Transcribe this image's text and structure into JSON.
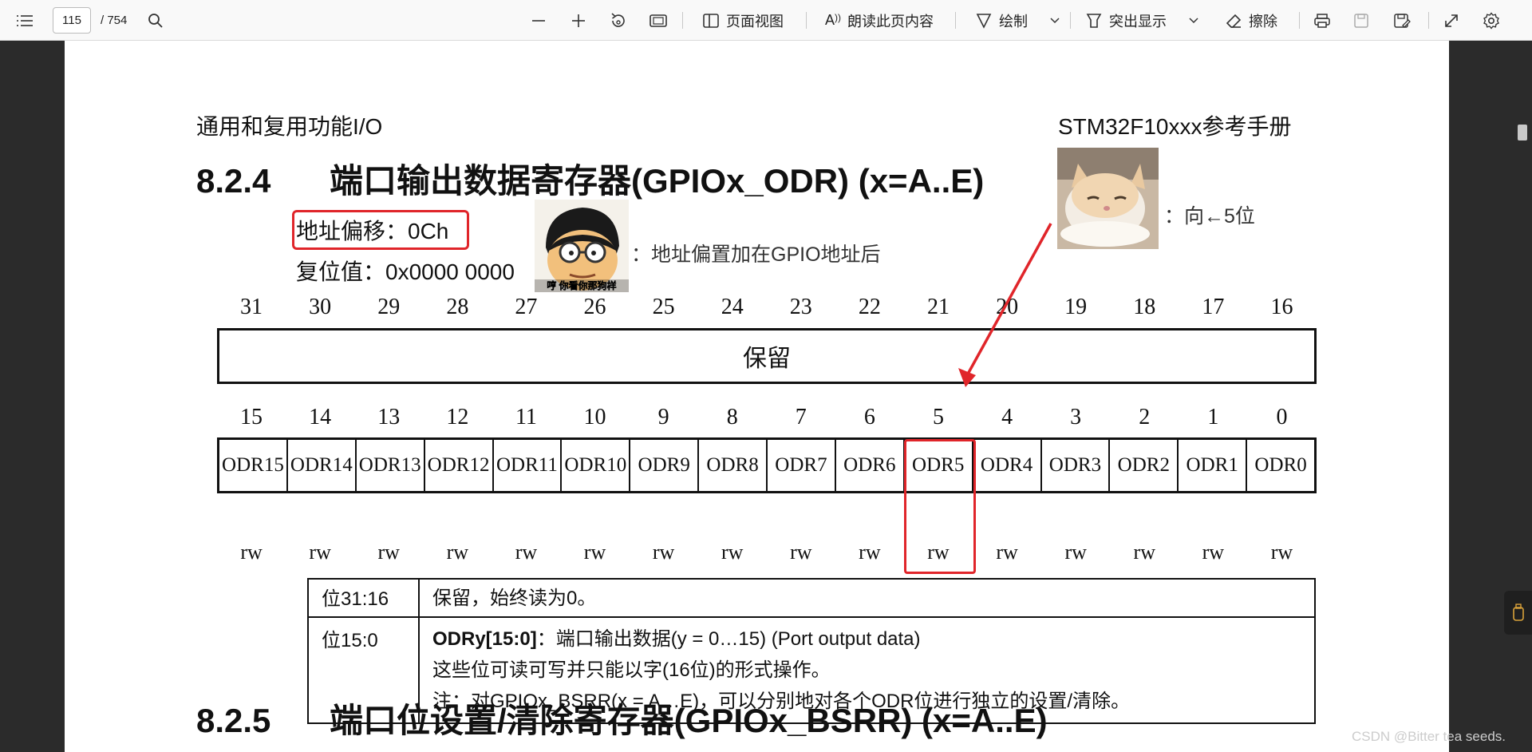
{
  "toolbar": {
    "page_current": "115",
    "page_total": "/ 754",
    "page_view_label": "页面视图",
    "read_aloud_label": "朗读此页内容",
    "draw_label": "绘制",
    "highlight_label": "突出显示",
    "erase_label": "擦除"
  },
  "document": {
    "header_left": "通用和复用功能I/O",
    "header_right": "STM32F10xxx参考手册",
    "section_824_num": "8.2.4",
    "section_824_title": "端口输出数据寄存器(GPIOx_ODR) (x=A..E)",
    "address_offset": "地址偏移：0Ch",
    "reset_value": "复位值：0x0000 0000",
    "meme1_caption": "哼 你看你那狗样",
    "annotation_offset": "：地址偏置加在GPIO地址后",
    "annotation_shift": "：向←5位",
    "upper_bit_numbers": [
      "31",
      "30",
      "29",
      "28",
      "27",
      "26",
      "25",
      "24",
      "23",
      "22",
      "21",
      "20",
      "19",
      "18",
      "17",
      "16"
    ],
    "reserved_label": "保留",
    "lower_bit_numbers": [
      "15",
      "14",
      "13",
      "12",
      "11",
      "10",
      "9",
      "8",
      "7",
      "6",
      "5",
      "4",
      "3",
      "2",
      "1",
      "0"
    ],
    "bit_fields": [
      "ODR15",
      "ODR14",
      "ODR13",
      "ODR12",
      "ODR11",
      "ODR10",
      "ODR9",
      "ODR8",
      "ODR7",
      "ODR6",
      "ODR5",
      "ODR4",
      "ODR3",
      "ODR2",
      "ODR1",
      "ODR0"
    ],
    "access": [
      "rw",
      "rw",
      "rw",
      "rw",
      "rw",
      "rw",
      "rw",
      "rw",
      "rw",
      "rw",
      "rw",
      "rw",
      "rw",
      "rw",
      "rw",
      "rw"
    ],
    "desc_rows": [
      {
        "bits": "位31:16",
        "text": "保留，始终读为0。"
      },
      {
        "bits": "位15:0",
        "title": "ODRy[15:0]",
        "title_rest": "：端口输出数据(y = 0…15) (Port output data)",
        "line2": "这些位可读可写并只能以字(16位)的形式操作。",
        "line3": "注：对GPIOx_BSRR(x = A…E)，可以分别地对各个ODR位进行独立的设置/清除。"
      }
    ],
    "section_825_num": "8.2.5",
    "section_825_title": "端口位设置/清除寄存器(GPIOx_BSRR) (x=A..E)"
  },
  "watermark": "CSDN @Bitter tea seeds.",
  "colors": {
    "accent_red": "#e0252a"
  }
}
